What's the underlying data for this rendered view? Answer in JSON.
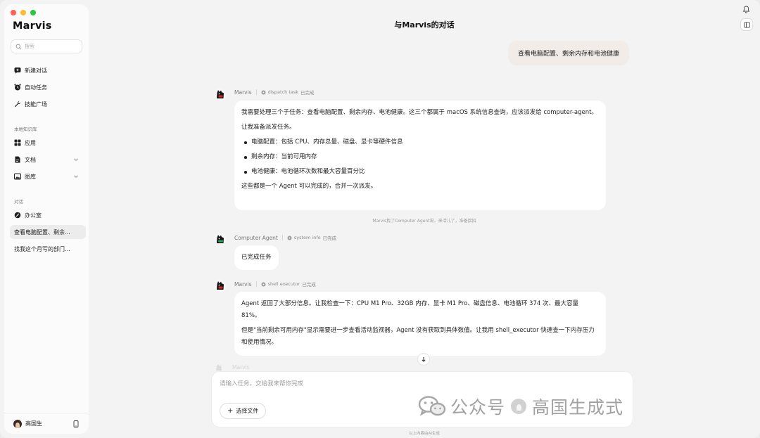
{
  "app": {
    "brand": "Marvis"
  },
  "sidebar": {
    "search_placeholder": "搜索",
    "nav": [
      {
        "label": "新建对话",
        "icon": "new-chat-icon"
      },
      {
        "label": "自动任务",
        "icon": "alarm-clock-icon"
      },
      {
        "label": "技能广场",
        "icon": "wrench-icon"
      }
    ],
    "knowledge_title": "本地知识库",
    "knowledge": [
      {
        "label": "应用",
        "icon": "grid-icon"
      },
      {
        "label": "文档",
        "icon": "document-icon"
      },
      {
        "label": "图库",
        "icon": "image-icon"
      }
    ],
    "conversations_title": "对话",
    "conversations": [
      {
        "label": "办公室"
      },
      {
        "label": "查看电脑配置、剩余..."
      },
      {
        "label": "找我这个月写的部门..."
      }
    ],
    "user": {
      "name": "高国生"
    }
  },
  "main": {
    "title": "与Marvis的对话",
    "user_message": "查看电脑配置、剩余内存和电池健康",
    "messages": [
      {
        "sender": "Marvis",
        "tool": "dispatch task",
        "status": "已完成",
        "paragraph1": "我需要处理三个子任务：查看电脑配置、剩余内存、电池健康。这三个都属于 macOS 系统信息查询，应该派发给 computer-agent。",
        "paragraph2": "让我准备派发任务。",
        "bullets": [
          "电脑配置：包括 CPU、内存总量、磁盘、显卡等硬件信息",
          "剩余内存：当前可用内存",
          "电池健康：电池循环次数和最大容量百分比"
        ],
        "paragraph3": "这些都是一个 Agent 可以完成的，合并一次派发。"
      },
      {
        "sender": "Computer Agent",
        "tool": "system info",
        "status": "已完成",
        "text": "已完成任务"
      },
      {
        "sender": "Marvis",
        "tool": "shell executor",
        "status": "已完成",
        "paragraph1": "Agent 返回了大部分信息。让我检查一下：CPU M1 Pro、32GB 内存、显卡 M1 Pro、磁盘信息、电池循环 374 次、最大容量 81%。",
        "paragraph2": "但是\"当前剩余可用内存\"显示需要进一步查看活动监视器，Agent 没有获取到具体数值。让我用 shell_executor 快速查一下内存压力和使用情况。"
      }
    ],
    "handoff_note": "Marvis找了Computer Agent说，来活儿了，准备接招",
    "faded_sender": "Marvis",
    "composer_placeholder": "请输入任务，交给我来帮你完成",
    "file_button": "选择文件",
    "file_button_plus": "+",
    "footer_note": "以上内容由AI生成"
  },
  "watermark": {
    "text1": "公众号",
    "text2": "高国生成式"
  },
  "colors": {
    "window_bg": "#f3f3f3",
    "sidebar_bg": "#fbfbfb",
    "user_bubble": "#f1ece8",
    "bubble_bg": "#ffffff"
  }
}
